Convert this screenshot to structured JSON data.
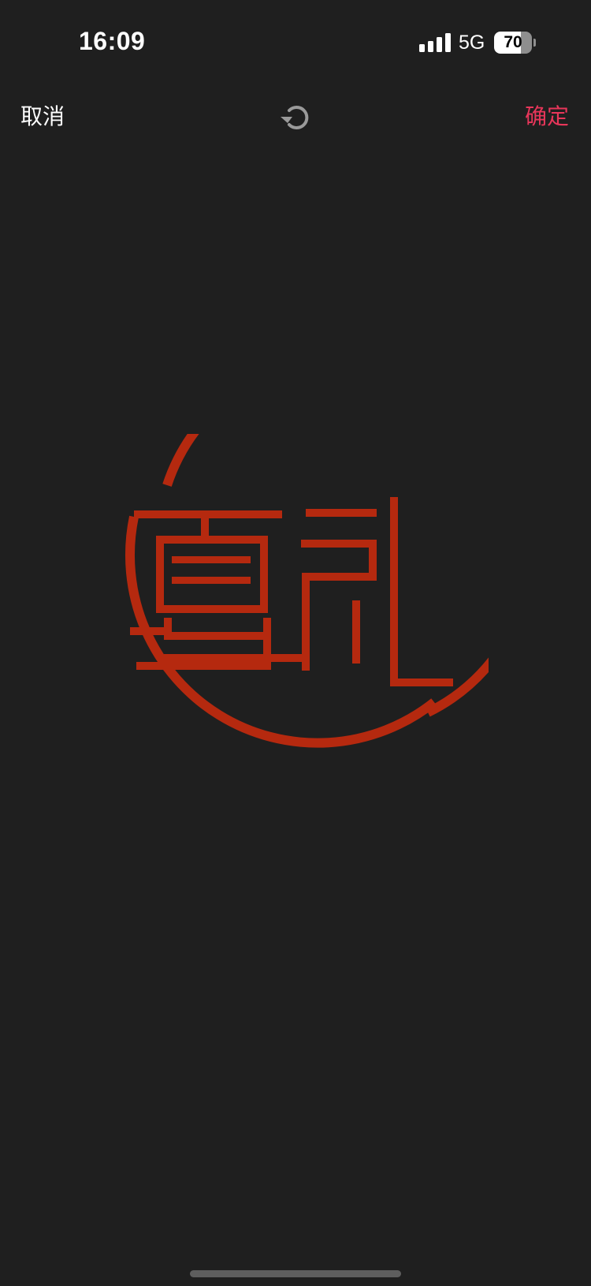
{
  "status_bar": {
    "time": "16:09",
    "network": "5G",
    "battery_level": "70",
    "battery_fraction": 0.7
  },
  "toolbar": {
    "cancel_label": "取消",
    "confirm_label": "确定",
    "reset_icon": "rotate-ccw-icon",
    "confirm_color": "#e8365a"
  },
  "seal": {
    "color": "#b5290f",
    "shape": "circle"
  }
}
